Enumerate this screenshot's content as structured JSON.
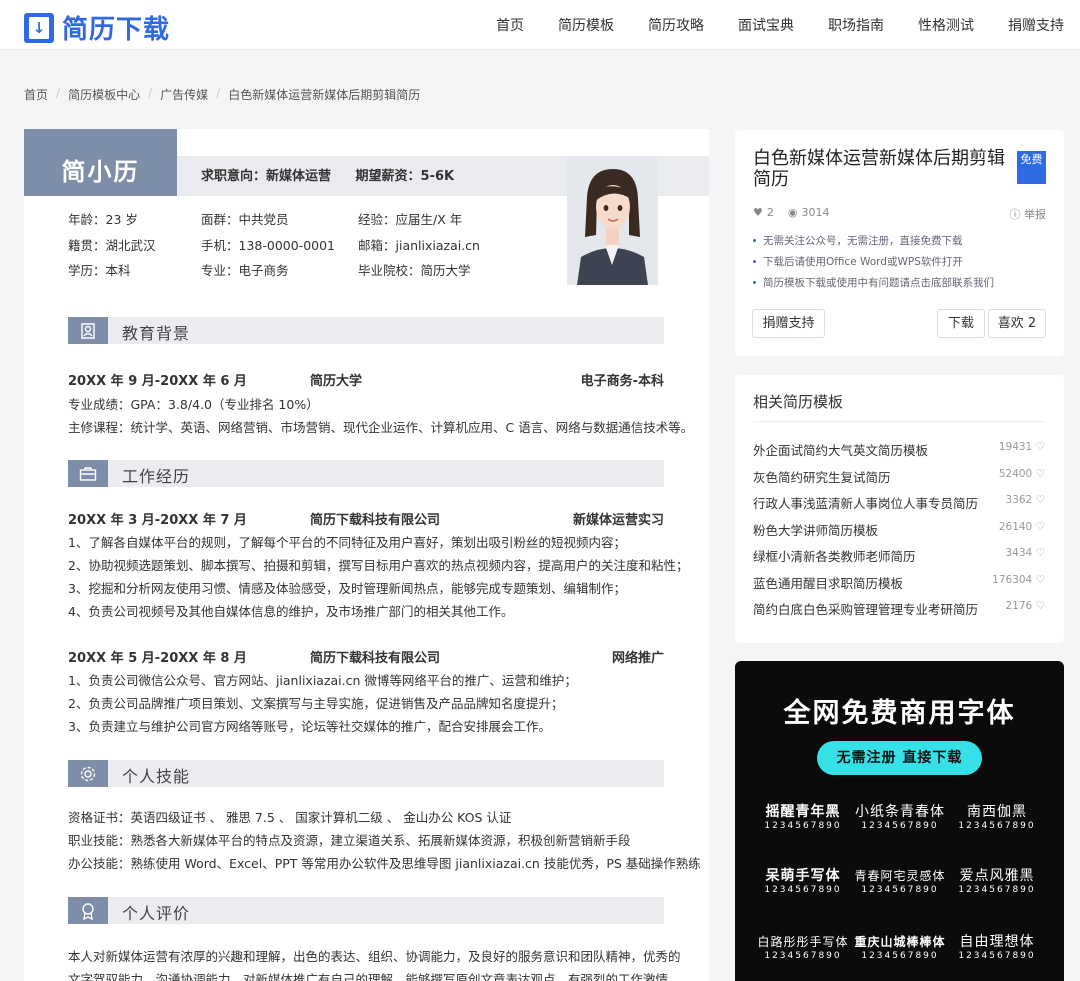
{
  "header": {
    "logo_text": "简历下载",
    "nav": [
      "首页",
      "简历模板",
      "简历攻略",
      "面试宝典",
      "职场指南",
      "性格测试",
      "捐赠支持"
    ]
  },
  "breadcrumb": [
    "首页",
    "简历模板中心",
    "广告传媒",
    "白色新媒体运营新媒体后期剪辑简历"
  ],
  "resume": {
    "name": "简小历",
    "intent_label": "求职意向：新媒体运营",
    "salary_label": "期望薪资：5-6K",
    "info": [
      [
        "年龄：23 岁",
        "面群：中共党员",
        "经验：应届生/X 年"
      ],
      [
        "籍贯：湖北武汉",
        "手机：138-0000-0001",
        "邮箱：jianlixiazai.cn"
      ],
      [
        "学历：本科",
        "专业：电子商务",
        "毕业院校：简历大学"
      ]
    ],
    "education": {
      "title": "教育背景",
      "date": "20XX 年 9 月-20XX 年 6 月",
      "school": "简历大学",
      "major": "电子商务-本科",
      "lines": [
        "专业成绩：GPA：3.8/4.0（专业排名 10%）",
        "主修课程：统计学、英语、网络营销、市场营销、现代企业运作、计算机应用、C 语言、网络与数据通信技术等。"
      ]
    },
    "work": {
      "title": "工作经历",
      "jobs": [
        {
          "date": "20XX 年 3 月-20XX 年 7 月",
          "company": "简历下载科技有限公司",
          "role": "新媒体运营实习",
          "lines": [
            "1、了解各自媒体平台的规则，了解每个平台的不同特征及用户喜好，策划出吸引粉丝的短视频内容；",
            "2、协助视频选题策划、脚本撰写、拍摄和剪辑，撰写目标用户喜欢的热点视频内容，提高用户的关注度和粘性；",
            "3、挖掘和分析网友使用习惯、情感及体验感受，及时管理新闻热点，能够完成专题策划、编辑制作；",
            "4、负责公司视频号及其他自媒体信息的维护，及市场推广部门的相关其他工作。"
          ]
        },
        {
          "date": "20XX 年 5 月-20XX 年 8 月",
          "company": "简历下载科技有限公司",
          "role": "网络推广",
          "lines": [
            "1、负责公司微信公众号、官方网站、jianlixiazai.cn 微博等网络平台的推广、运营和维护；",
            "2、负责公司品牌推广项目策划、文案撰写与主导实施，促进销售及产品品牌知名度提升；",
            "3、负责建立与维护公司官方网络等账号，论坛等社交媒体的推广，配合安排展会工作。"
          ]
        }
      ]
    },
    "skills": {
      "title": "个人技能",
      "lines": [
        "资格证书：英语四级证书 、 雅思 7.5 、 国家计算机二级 、 金山办公 KOS 认证",
        "职业技能：熟悉各大新媒体平台的特点及资源，建立渠道关系、拓展新媒体资源，积极创新营销新手段",
        "办公技能：熟练使用 Word、Excel、PPT 等常用办公软件及思维导图 jianlixiazai.cn 技能优秀，PS 基础操作熟练"
      ]
    },
    "evaluation": {
      "title": "个人评价",
      "lines": [
        "本人对新媒体运营有浓厚的兴趣和理解，出色的表达、组织、协调能力，及良好的服务意识和团队精神，优秀的",
        "文字驾驭能力、沟通协调能力，对新媒体推广有自己的理解，能够撰写原创文章表达观点，有强烈的工作激情。"
      ]
    }
  },
  "template_card": {
    "title": "白色新媒体运营新媒体后期剪辑简历",
    "badge": "免费",
    "likes": "2",
    "views": "3014",
    "report": "举报",
    "tips": [
      "无需关注公众号，无需注册，直接免费下载",
      "下载后请使用Office Word或WPS软件打开",
      "简历模板下载或使用中有问题请点击底部联系我们"
    ],
    "donate_button": "捐赠支持",
    "download_button": "下载",
    "like_button": "喜欢 2"
  },
  "related": {
    "title": "相关简历模板",
    "items": [
      {
        "name": "外企面试简约大气英文简历模板",
        "count": "19431"
      },
      {
        "name": "灰色简约研究生复试简历",
        "count": "52400"
      },
      {
        "name": "行政人事浅蓝清新人事岗位人事专员简历",
        "count": "3362"
      },
      {
        "name": "粉色大学讲师简历模板",
        "count": "26140"
      },
      {
        "name": "绿框小清新各类教师老师简历",
        "count": "3434"
      },
      {
        "name": "蓝色通用醒目求职简历模板",
        "count": "176304"
      },
      {
        "name": "简约白底白色采购管理管理专业考研简历",
        "count": "2176"
      }
    ]
  },
  "ad": {
    "title": "全网免费商用字体",
    "button": "无需注册 直接下载",
    "fonts": [
      "摇醒青年黑",
      "小纸条青春体",
      "南西伽黑",
      "呆萌手写体",
      "青春阿宅灵感体",
      "爱点风雅黑",
      "白路彤彤手写体",
      "重庆山城棒棒体",
      "自由理想体"
    ],
    "digits": "1234567890"
  },
  "colors": {
    "accent": "#2e6ae3",
    "resume_accent": "#7e8ea8",
    "ad_button": "#35e0e6"
  }
}
